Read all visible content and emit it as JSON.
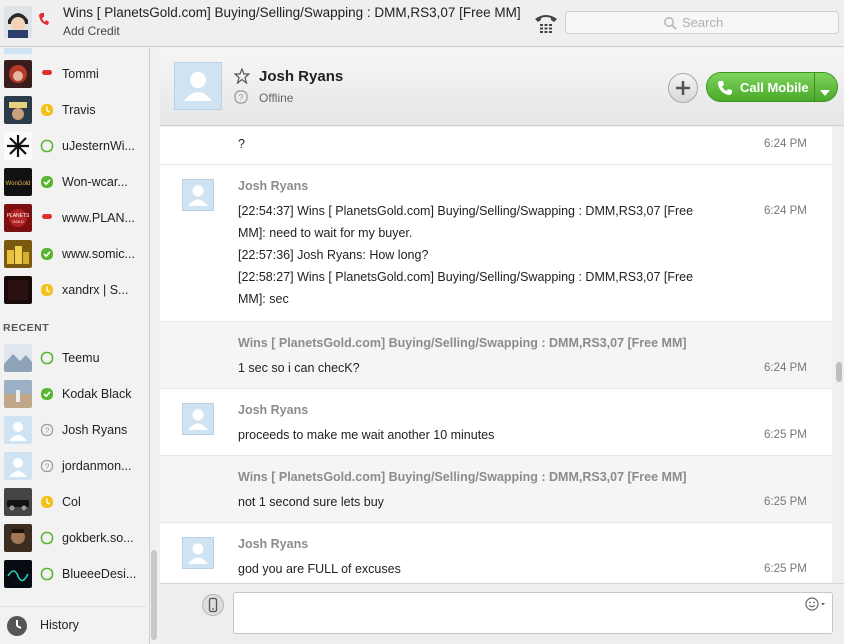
{
  "topbar": {
    "name": "Wins [ PlanetsGold.com] Buying/Selling/Swapping : DMM,RS3,07 [Free MM]",
    "mood": "Add Credit",
    "search_placeholder": "Search"
  },
  "colors": {
    "online": "#5bb531",
    "away": "#f2c21b",
    "busy": "#e02f2f",
    "offline": "#9a9a9a",
    "call_green": "#4aa92a"
  },
  "sidebar": {
    "contacts": [
      {
        "name": "Tommi",
        "status": "busy",
        "avatar": "red-hair"
      },
      {
        "name": "Travis",
        "status": "away",
        "avatar": "hat"
      },
      {
        "name": "uJesternWi...",
        "status": "online-empty",
        "avatar": "star"
      },
      {
        "name": "Won-wcar...",
        "status": "online",
        "avatar": "wongold"
      },
      {
        "name": "www.PLAN...",
        "status": "busy",
        "avatar": "planets"
      },
      {
        "name": "www.somic...",
        "status": "online",
        "avatar": "coins"
      },
      {
        "name": "xandrx | S...",
        "status": "away",
        "avatar": "dark"
      }
    ],
    "recent_label": "RECENT",
    "recent": [
      {
        "name": "Teemu",
        "status": "online-empty",
        "avatar": "snow"
      },
      {
        "name": "Kodak Black",
        "status": "online",
        "avatar": "sky"
      },
      {
        "name": "Josh Ryans",
        "status": "offline",
        "avatar": "default"
      },
      {
        "name": "jordanmon...",
        "status": "offline",
        "avatar": "default"
      },
      {
        "name": "Col",
        "status": "away",
        "avatar": "car"
      },
      {
        "name": "gokberk.so...",
        "status": "online-empty",
        "avatar": "face"
      },
      {
        "name": "BlueeeDesi...",
        "status": "online-empty",
        "avatar": "neon"
      }
    ],
    "history_label": "History"
  },
  "conversation": {
    "name": "Josh Ryans",
    "status": "Offline",
    "call_label": "Call Mobile"
  },
  "messages": [
    {
      "sender": "",
      "lines": [
        "?"
      ],
      "time": "6:24 PM",
      "avatar": false,
      "alt": false
    },
    {
      "sender": "Josh Ryans",
      "lines": [
        "[22:54:37] Wins [ PlanetsGold.com] Buying/Selling/Swapping : DMM,RS3,07 [Free",
        "MM]: need to wait for my buyer.",
        "[22:57:36] Josh Ryans: How long?",
        "[22:58:27] Wins [ PlanetsGold.com] Buying/Selling/Swapping : DMM,RS3,07 [Free",
        "MM]: sec"
      ],
      "time": "6:24 PM",
      "avatar": true,
      "alt": false
    },
    {
      "sender": "Wins [ PlanetsGold.com] Buying/Selling/Swapping : DMM,RS3,07 [Free MM]",
      "lines": [
        "1 sec so i can checK?"
      ],
      "time": "6:24 PM",
      "avatar": false,
      "alt": true
    },
    {
      "sender": "Josh Ryans",
      "lines": [
        "proceeds to make me wait another 10 minutes"
      ],
      "time": "6:25 PM",
      "avatar": true,
      "alt": false
    },
    {
      "sender": "Wins [ PlanetsGold.com] Buying/Selling/Swapping : DMM,RS3,07 [Free MM]",
      "lines": [
        "not 1 second sure lets buy"
      ],
      "time": "6:25 PM",
      "avatar": false,
      "alt": true
    },
    {
      "sender": "Josh Ryans",
      "lines": [
        "god you are FULL of excuses"
      ],
      "time": "6:25 PM",
      "avatar": true,
      "alt": false
    }
  ],
  "composer": {
    "placeholder": ""
  }
}
